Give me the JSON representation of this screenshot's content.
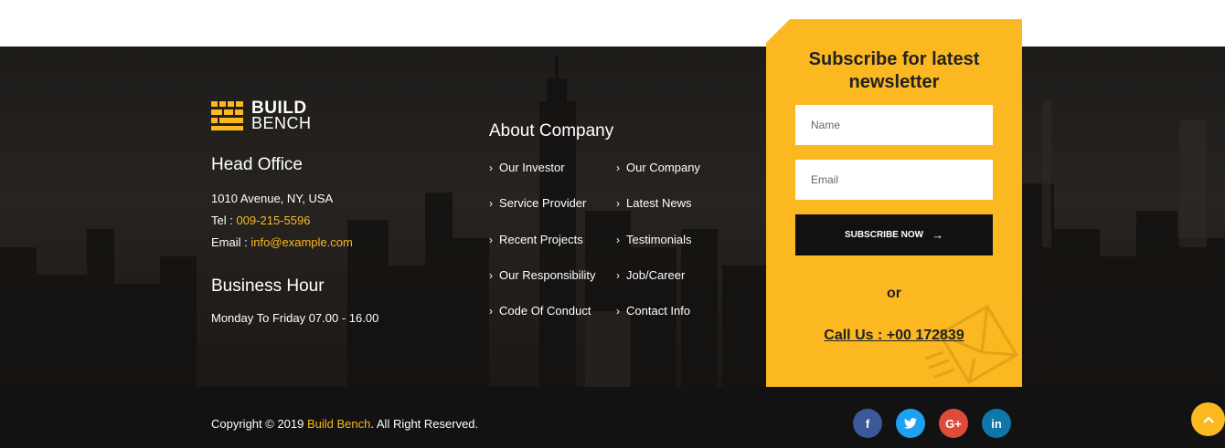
{
  "brand": {
    "line1": "BUILD",
    "line2": "BENCH"
  },
  "head_office": {
    "title": "Head Office",
    "address": "1010 Avenue, NY, USA",
    "tel_label": "Tel : ",
    "tel_value": "009-215-5596",
    "email_label": "Email : ",
    "email_value": "info@example.com"
  },
  "business_hour": {
    "title": "Business Hour",
    "hours": "Monday To Friday 07.00 - 16.00"
  },
  "about": {
    "title": "About Company",
    "links": [
      "Our Investor",
      "Our Company",
      "Service Provider",
      "Latest News",
      "Recent Projects",
      "Testimonials",
      "Our Responsibility",
      "Job/Career",
      "Code Of Conduct",
      "Contact Info"
    ]
  },
  "subscribe": {
    "title_line1": "Subscribe for latest",
    "title_line2": "newsletter",
    "name_placeholder": "Name",
    "email_placeholder": "Email",
    "button_label": "SUBSCRIBE NOW",
    "or_text": "or",
    "call_text": "Call Us : +00 172839"
  },
  "footer": {
    "copyright_prefix": "Copyright © 2019 ",
    "copyright_brand": "Build Bench",
    "copyright_suffix": ". All Right Reserved."
  },
  "social": [
    {
      "icon": "facebook-icon",
      "glyph": "f",
      "color": "#3b5998"
    },
    {
      "icon": "twitter-icon",
      "glyph": "t",
      "color": "#1da1f2"
    },
    {
      "icon": "google-plus-icon",
      "glyph": "G+",
      "color": "#dd4b39"
    },
    {
      "icon": "linkedin-icon",
      "glyph": "in",
      "color": "#0e76a8"
    }
  ],
  "colors": {
    "accent": "#fbb820",
    "dark": "#121212"
  }
}
